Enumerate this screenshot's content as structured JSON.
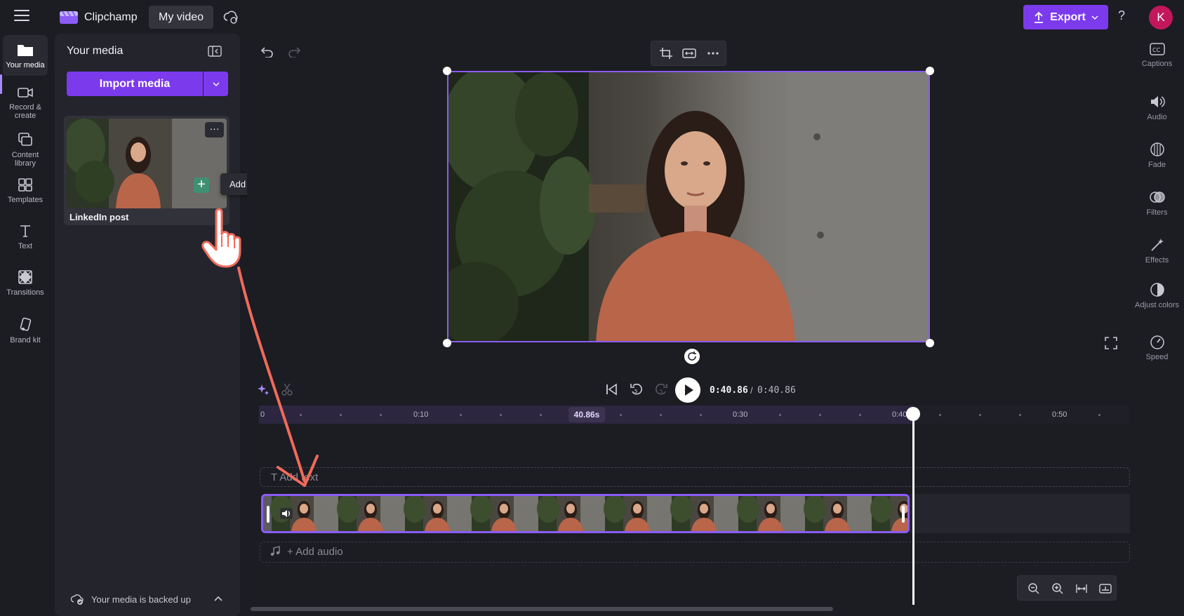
{
  "app": {
    "name": "Clipchamp",
    "project_name": "My video",
    "export_label": "Export",
    "help_label": "?",
    "avatar_initial": "K",
    "accent": "#7c3aed"
  },
  "leftnav": {
    "items": [
      {
        "label": "Your media",
        "icon": "folder-icon"
      },
      {
        "label": "Record & create",
        "icon": "camera-icon"
      },
      {
        "label": "Content library",
        "icon": "library-icon"
      },
      {
        "label": "Templates",
        "icon": "templates-icon"
      },
      {
        "label": "Text",
        "icon": "text-icon"
      },
      {
        "label": "Transitions",
        "icon": "transitions-icon"
      },
      {
        "label": "Brand kit",
        "icon": "brand-kit-icon"
      }
    ]
  },
  "media_panel": {
    "title": "Your media",
    "import_label": "Import media",
    "items": [
      {
        "label": "LinkedIn post"
      }
    ],
    "more_label": "···",
    "add_label": "+",
    "tooltip": "Add to timeline",
    "backup_status": "Your media is backed up"
  },
  "rightnav": {
    "items": [
      {
        "label": "Captions",
        "icon": "captions-icon"
      },
      {
        "label": "Audio",
        "icon": "audio-icon"
      },
      {
        "label": "Fade",
        "icon": "fade-icon"
      },
      {
        "label": "Filters",
        "icon": "filters-icon"
      },
      {
        "label": "Effects",
        "icon": "effects-icon"
      },
      {
        "label": "Adjust colors",
        "icon": "adjust-colors-icon"
      },
      {
        "label": "Speed",
        "icon": "speed-icon"
      }
    ]
  },
  "timeline": {
    "current_time": "0:40.86",
    "separator": "/",
    "total_time": "0:40.86",
    "rewind_seconds": "5",
    "forward_seconds": "5",
    "marker_time": "40.86s",
    "ticks": [
      "0",
      "0:10",
      "0:30",
      "0:40",
      "0:50"
    ],
    "text_track_label": "T    Add text",
    "audio_track_label": "+ Add audio"
  }
}
